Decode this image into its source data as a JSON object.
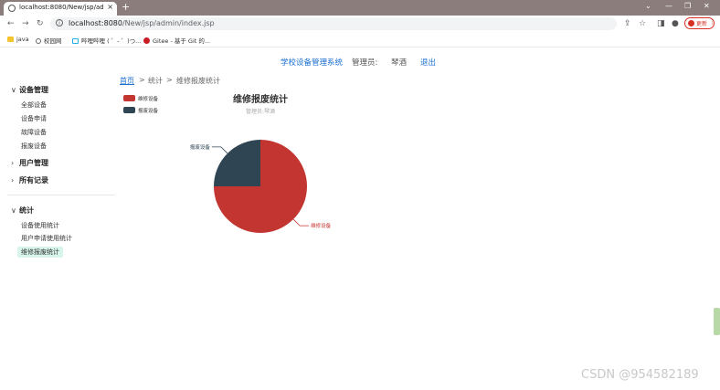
{
  "browser": {
    "tab_title": "localhost:8080/New/jsp/admi",
    "tab_close": "×",
    "new_tab": "+",
    "url_host": "localhost:8080",
    "url_path": "/New/jsp/admin/index.jsp",
    "update_label": "更新",
    "bookmarks": [
      "java",
      "校园网",
      "哔哩哔哩 ( ゜- ゜)つ...",
      "Gitee - 基于 Git 的..."
    ]
  },
  "header": {
    "app_title": "学校设备管理系统",
    "admin_label": "管理员:",
    "admin_name": "琴酒",
    "logout_label": "退出"
  },
  "breadcrumb": {
    "home": "首页",
    "sep": ">",
    "level1": "统计",
    "level2": "维修报废统计"
  },
  "sidebar": {
    "groups": [
      {
        "label": "设备管理",
        "expanded": true,
        "items": [
          "全部设备",
          "设备申请",
          "故障设备",
          "报废设备"
        ]
      },
      {
        "label": "用户管理",
        "expanded": false,
        "items": []
      },
      {
        "label": "所有记录",
        "expanded": false,
        "items": []
      },
      {
        "label": "统计",
        "expanded": true,
        "items": [
          "设备使用统计",
          "用户申请使用统计",
          "维修报废统计"
        ],
        "active": "维修报废统计"
      }
    ]
  },
  "chart_data": {
    "type": "pie",
    "title": "维修报废统计",
    "subtitle": "管理员:琴酒",
    "legend_position": "top-left",
    "slices": [
      {
        "name": "维修设备",
        "value": 75,
        "color": "#c23531"
      },
      {
        "name": "报废设备",
        "value": 25,
        "color": "#2f4554"
      }
    ]
  },
  "watermark": "CSDN @954582189"
}
